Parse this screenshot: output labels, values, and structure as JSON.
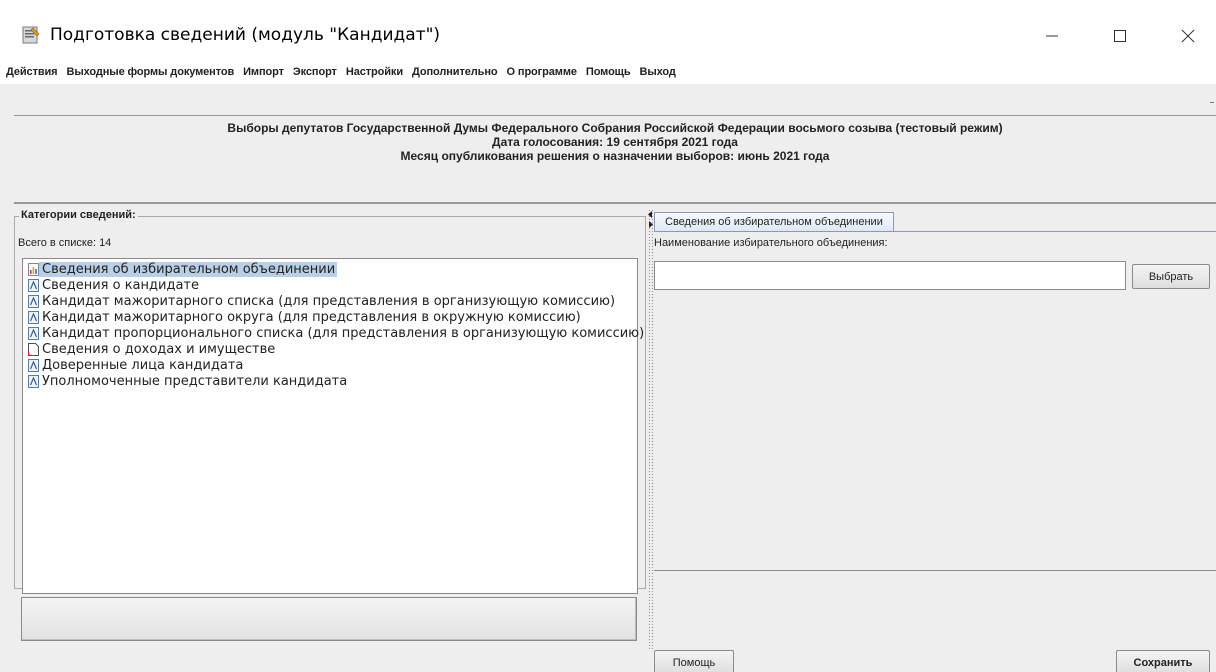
{
  "window": {
    "title": "Подготовка сведений (модуль \"Кандидат\")",
    "icons": [
      "app-icon",
      "minimize-icon",
      "maximize-icon",
      "close-icon"
    ]
  },
  "menu": {
    "items": [
      "Действия",
      "Выходные формы документов",
      "Импорт",
      "Экспорт",
      "Настройки",
      "Дополнительно",
      "О программе",
      "Помощь",
      "Выход"
    ]
  },
  "header": {
    "line1": "Выборы депутатов Государственной Думы Федерального Собрания Российской Федерации восьмого созыва (тестовый режим)",
    "line2": "Дата голосования: 19 сентября 2021 года",
    "line3": "Месяц опубликования решения о назначении выборов: июнь 2021 года"
  },
  "categories": {
    "legend": "Категории сведений:",
    "count_label": "Всего в списке: 14",
    "items": [
      {
        "label": "Сведения об избирательном объединении",
        "icon": "doc-chart-icon",
        "selected": true
      },
      {
        "label": "Сведения о кандидате",
        "icon": "doc-icon",
        "selected": false
      },
      {
        "label": "Кандидат мажоритарного списка (для представления в организующую комиссию)",
        "icon": "doc-icon",
        "selected": false
      },
      {
        "label": "Кандидат мажоритарного округа (для представления в окружную комиссию)",
        "icon": "doc-icon",
        "selected": false
      },
      {
        "label": "Кандидат пропорционального списка (для представления в организующую комиссию)",
        "icon": "doc-icon",
        "selected": false
      },
      {
        "label": "Сведения о доходах и имуществе",
        "icon": "doc-red-icon",
        "selected": false
      },
      {
        "label": "Доверенные лица кандидата",
        "icon": "doc-icon",
        "selected": false
      },
      {
        "label": "Уполномоченные представители кандидата",
        "icon": "doc-icon",
        "selected": false
      }
    ]
  },
  "detail": {
    "tab_label": "Сведения об избирательном объединении",
    "field_label": "Наименование избирательного объединения:",
    "field_value": "",
    "choose_button": "Выбрать",
    "help_button": "Помощь",
    "save_button": "Сохранить"
  },
  "colors": {
    "selection": "#b8cfe5",
    "background": "#eeeeee",
    "tab_border": "#8a9bb0"
  }
}
